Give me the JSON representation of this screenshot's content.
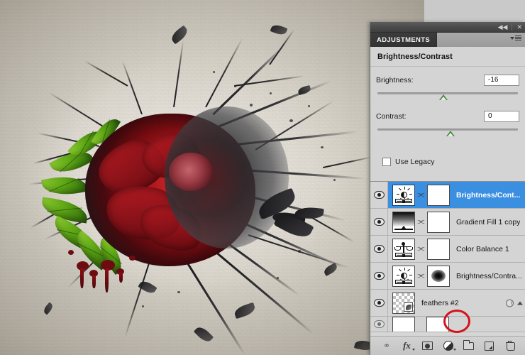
{
  "app": {
    "panel_titlebar": {
      "collapse_icon": "collapse-double-arrow-icon",
      "collapse_glyph": "◀◀",
      "close_icon": "close-icon",
      "close_glyph": "✕"
    },
    "tabs": [
      {
        "label": "ADJUSTMENTS",
        "active": true
      }
    ],
    "panel_menu_icon": "panel-menu-icon"
  },
  "adjustments": {
    "title": "Brightness/Contrast",
    "sliders": [
      {
        "label": "Brightness:",
        "value": "-16",
        "thumb_percent": 44
      },
      {
        "label": "Contrast:",
        "value": "0",
        "thumb_percent": 49
      }
    ],
    "checkbox": {
      "label": "Use Legacy",
      "checked": false
    }
  },
  "layers": {
    "rows": [
      {
        "name": "Brightness/Cont...",
        "thumb": "brightness-contrast-icon",
        "mask": "white-mask",
        "visible": true,
        "selected": true,
        "link_glyph": "⫘"
      },
      {
        "name": "Gradient Fill 1 copy",
        "thumb": "gradient-fill-icon",
        "mask": "white-mask",
        "visible": true,
        "selected": false,
        "link_glyph": "⫘"
      },
      {
        "name": "Color Balance 1",
        "thumb": "color-balance-scales-icon",
        "mask": "white-mask",
        "visible": true,
        "selected": false,
        "link_glyph": "⫘"
      },
      {
        "name": "Brightness/Contra...",
        "thumb": "brightness-contrast-icon",
        "mask": "black-blob-mask",
        "visible": true,
        "selected": false,
        "link_glyph": "⫘"
      },
      {
        "name": "feathers #2",
        "thumb": "transparent-checker-thumb",
        "mask": null,
        "visible": true,
        "selected": false,
        "fx_badge": "layer-effects-icon",
        "scroll_arrow": "scroll-up-arrow-icon"
      }
    ],
    "toolbar": [
      {
        "icon": "link-layers-icon",
        "label": "Link layers"
      },
      {
        "icon": "layer-style-fx-icon",
        "label": "fx"
      },
      {
        "icon": "add-layer-mask-icon",
        "label": "Add layer mask"
      },
      {
        "icon": "new-adjustment-layer-icon",
        "label": "Create new fill or adjustment layer"
      },
      {
        "icon": "new-group-icon",
        "label": "Create a new group"
      },
      {
        "icon": "new-layer-icon",
        "label": "Create a new layer"
      },
      {
        "icon": "delete-layer-icon",
        "label": "Delete layer"
      }
    ]
  },
  "annotation": {
    "shape": "red-circle-highlight",
    "color": "#d4141b",
    "targets": "new-adjustment-layer-icon"
  },
  "artwork": {
    "description": "red-rose-with-black-branches-and-raven",
    "background_color": "#d8d4cb",
    "rose_color": "#a51419",
    "leaf_color": "#5faa15",
    "blood_color": "#6e0b10",
    "branch_color": "#1b1b1d"
  }
}
